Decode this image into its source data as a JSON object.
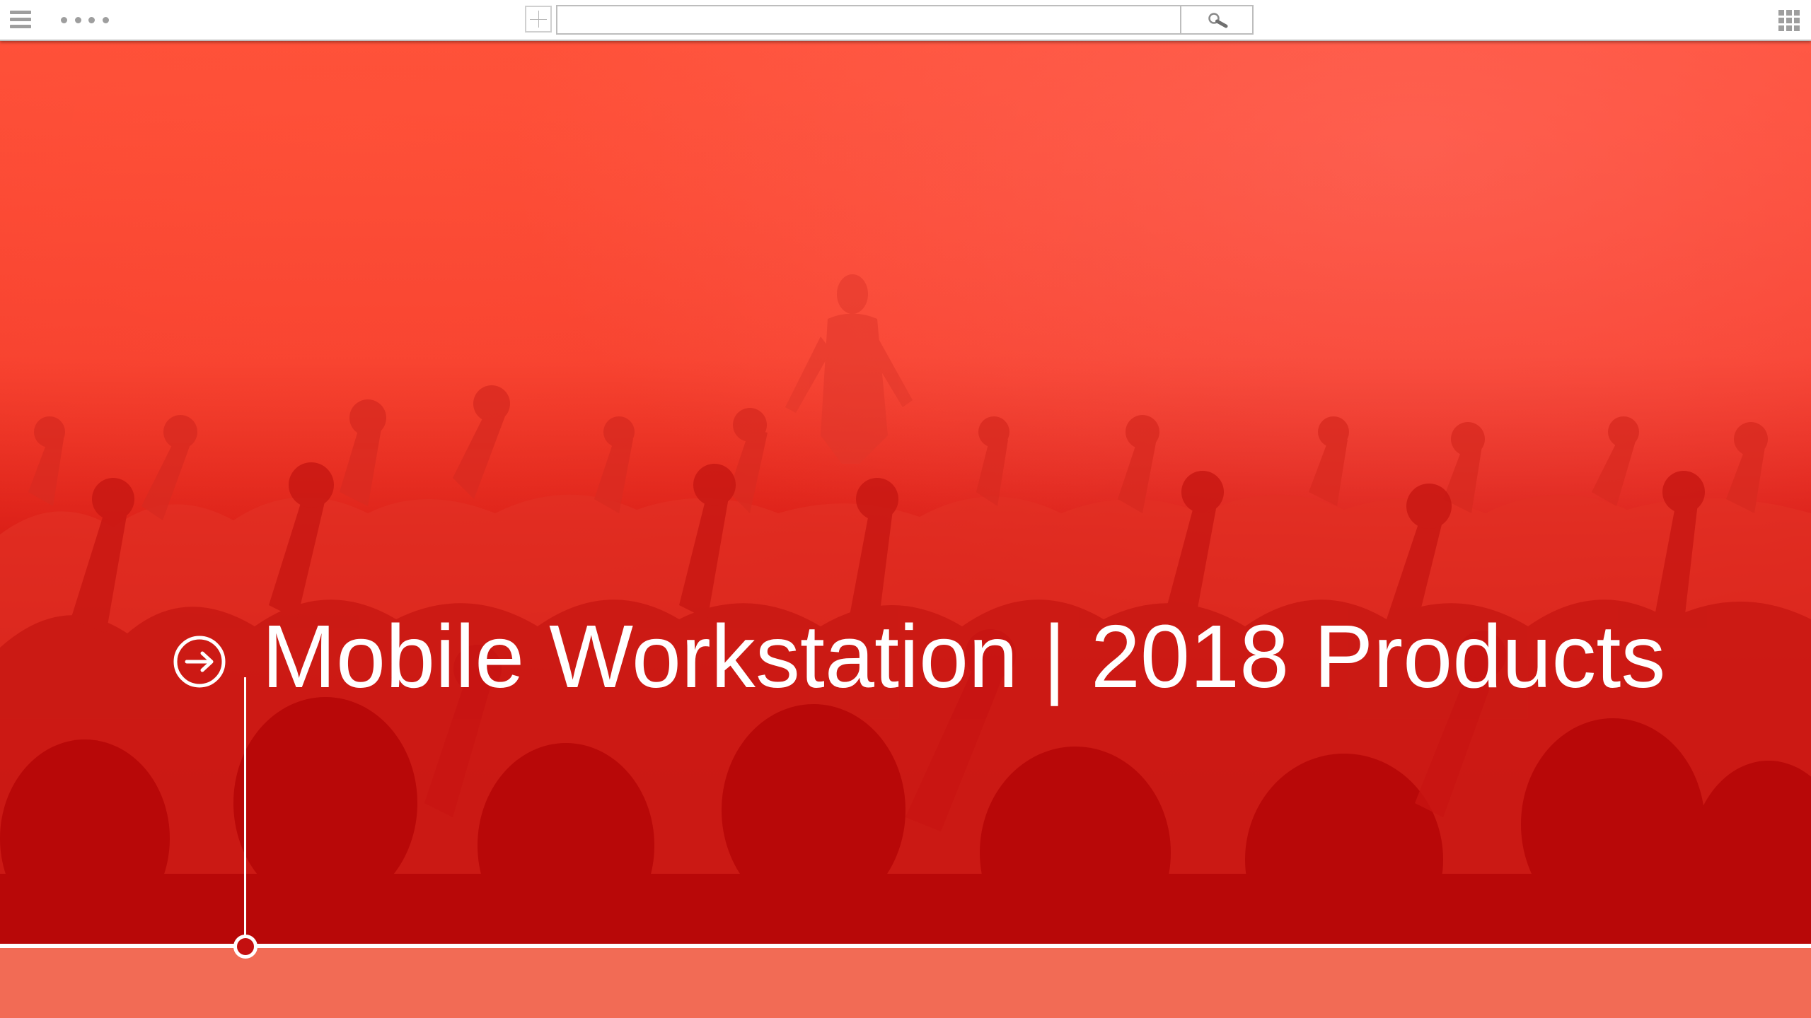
{
  "toolbar": {
    "menu_icon": "hamburger-icon",
    "more_icon": "more-dots-icon",
    "add_icon": "plus-icon",
    "search": {
      "value": "",
      "placeholder": ""
    },
    "search_icon": "magnifier-icon",
    "apps_icon": "grid-icon"
  },
  "slide": {
    "title_icon": "arrow-circle-right-icon",
    "title": "Mobile Workstation | 2018 Products"
  },
  "colors": {
    "accent_red": "#c41010",
    "background_top": "#ff4e38",
    "background_bottom": "#b80606",
    "footer_band": "#f26b55",
    "text": "#ffffff"
  }
}
